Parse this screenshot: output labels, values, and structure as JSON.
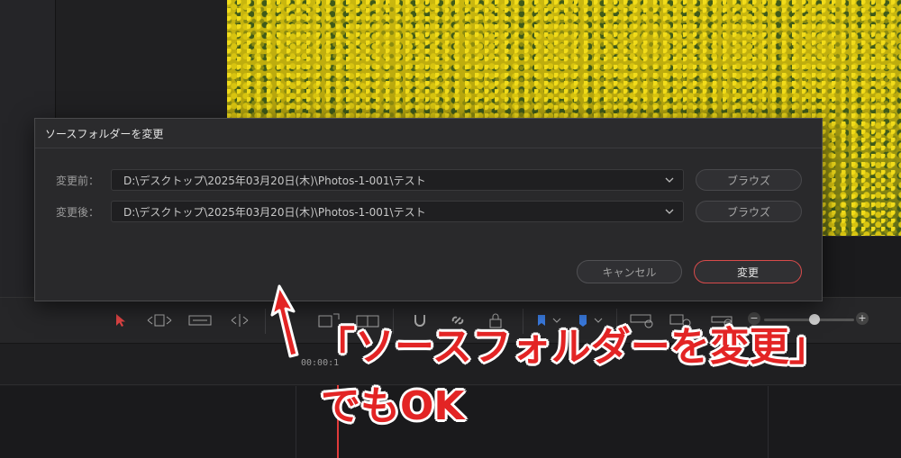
{
  "dialog": {
    "title": "ソースフォルダーを変更",
    "before": {
      "label": "変更前：",
      "path": "D:\\デスクトップ\\2025年03月20日(木)\\Photos-1-001\\テスト",
      "browse": "ブラウズ"
    },
    "after": {
      "label": "変更後：",
      "path": "D:\\デスクトップ\\2025年03月20日(木)\\Photos-1-001\\テスト",
      "browse": "ブラウズ"
    },
    "cancel": "キャンセル",
    "ok": "変更"
  },
  "timeline": {
    "timecode": "00:00:1"
  },
  "annotation": {
    "line1": "「ソースフォルダーを変更」",
    "line2": "でもOK"
  },
  "colors": {
    "accent_red": "#e32424",
    "ok_border": "#d84b4b",
    "playhead": "#e03a3a"
  }
}
